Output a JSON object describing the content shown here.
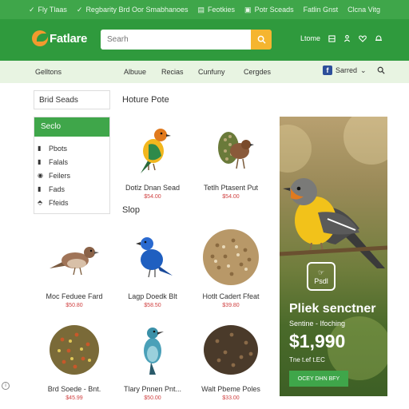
{
  "topbar": {
    "items": [
      {
        "icon": "check-icon",
        "glyph": "✓",
        "label": "Fly Tlaas"
      },
      {
        "icon": "check-icon",
        "glyph": "✓",
        "label": "Regbarity Brd Oor Smabhanoes"
      },
      {
        "icon": "list-icon",
        "glyph": "▤",
        "label": "Feotkies"
      },
      {
        "icon": "card-icon",
        "glyph": "▣",
        "label": "Potr Sceads"
      },
      {
        "icon": "",
        "glyph": "",
        "label": "Fatlin Gnst"
      },
      {
        "icon": "",
        "glyph": "",
        "label": "Clcna Vitg"
      }
    ]
  },
  "header": {
    "logo_text": "Fatlare",
    "search_placeholder": "Searh",
    "search_icon": "search-icon",
    "nav": {
      "home_label": "Ltome",
      "icons": [
        "grid-icon",
        "user-icon",
        "heart-icon",
        "bell-icon"
      ]
    }
  },
  "catnav": {
    "items": [
      "Gelltons",
      "Albuue",
      "Recias",
      "Cunfuny",
      "Cergdes"
    ],
    "signin_label": "Sarred",
    "search_icon": "search-icon"
  },
  "sidebar": {
    "title": "Brid Seads",
    "active": "Seclo",
    "items": [
      "Pbots",
      "Falals",
      "Feilers",
      "Fads",
      "Ffeids"
    ]
  },
  "sections": {
    "featured": "Hoture Pote",
    "shop": "Slop"
  },
  "products": [
    {
      "name": "Dotlz Dnan Sead",
      "price": "$54.00"
    },
    {
      "name": "Tetlh Ptasent Put",
      "price": "$54.00"
    },
    {
      "name": "Moc Feduee Fard",
      "price": "$50.80"
    },
    {
      "name": "Lagp Doedk Blt",
      "price": "$58.50"
    },
    {
      "name": "Hotlt Cadert Ffeat",
      "price": "$39.80"
    },
    {
      "name": "Brd Soede - Bnt.",
      "price": "$45.99"
    },
    {
      "name": "Tlary Pnnen Pnt...",
      "price": "$50.00"
    },
    {
      "name": "Walt Pbeme Poles",
      "price": "$33.00"
    }
  ],
  "banner": {
    "badge_icon": "hand-icon",
    "badge_label": "Psdl",
    "title": "Pliek senctner",
    "subtitle": "Sentine - Ifoching",
    "price": "$1,990",
    "small_text": "Tne t.ef t.EC",
    "button_label": "OCEY DHN BFY"
  },
  "colors": {
    "primary_green": "#2f9a3d",
    "accent_orange": "#f5b530",
    "price_red": "#d04040"
  }
}
